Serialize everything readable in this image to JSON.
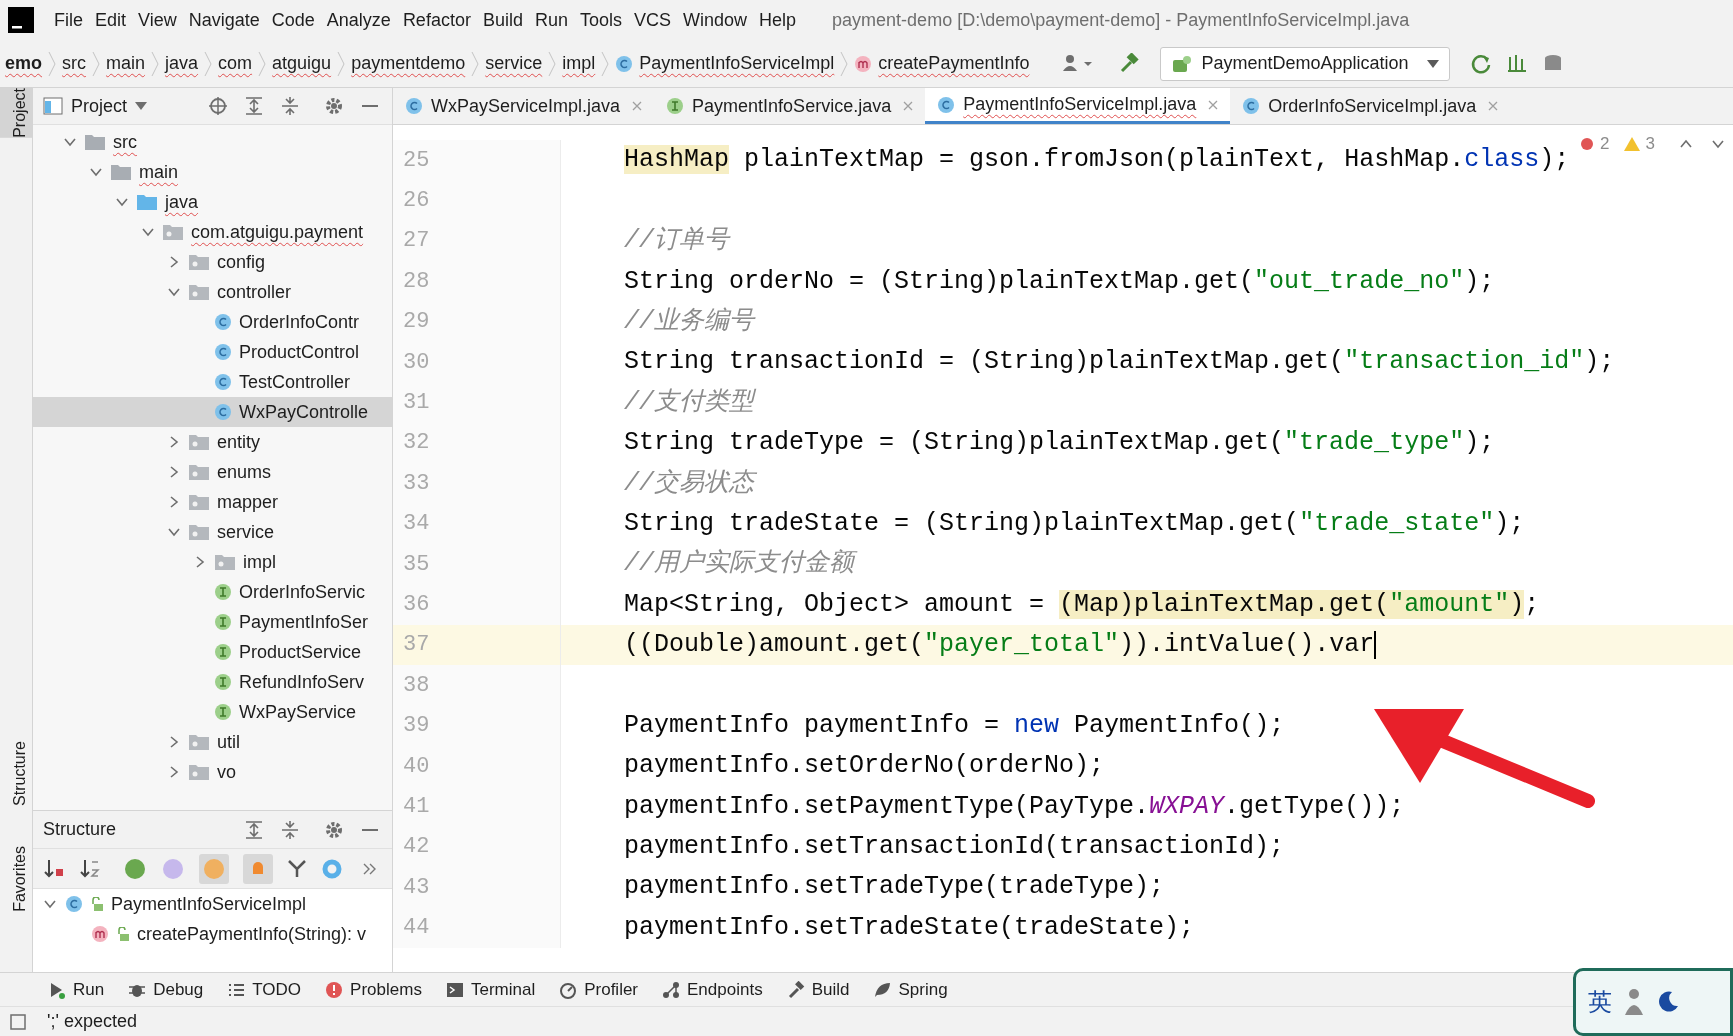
{
  "menu": [
    "File",
    "Edit",
    "View",
    "Navigate",
    "Code",
    "Analyze",
    "Refactor",
    "Build",
    "Run",
    "Tools",
    "VCS",
    "Window",
    "Help"
  ],
  "window": {
    "title": "payment-demo [D:\\demo\\payment-demo] - PaymentInfoServiceImpl.java"
  },
  "breadcrumbs": [
    {
      "label": "emo",
      "kind": "plain"
    },
    {
      "label": "src",
      "kind": "plain"
    },
    {
      "label": "main",
      "kind": "plain"
    },
    {
      "label": "java",
      "kind": "plain"
    },
    {
      "label": "com",
      "kind": "plain"
    },
    {
      "label": "atguigu",
      "kind": "plain"
    },
    {
      "label": "paymentdemo",
      "kind": "plain"
    },
    {
      "label": "service",
      "kind": "plain"
    },
    {
      "label": "impl",
      "kind": "plain"
    },
    {
      "label": "PaymentInfoServiceImpl",
      "kind": "class"
    },
    {
      "label": "createPaymentInfo",
      "kind": "method"
    }
  ],
  "run_config": "PaymentDemoApplication",
  "side_stripe": {
    "top": [
      {
        "label": "Project",
        "selected": true
      }
    ],
    "bottom": [
      {
        "label": "Structure",
        "selected": false
      },
      {
        "label": "Favorites",
        "selected": false
      }
    ]
  },
  "project_panel": {
    "title": "Project",
    "tree": [
      {
        "label": "src",
        "kind": "folder",
        "expanded": true,
        "selected": false,
        "children": [
          {
            "label": "main",
            "kind": "folder",
            "expanded": true,
            "selected": false,
            "children": [
              {
                "label": "java",
                "kind": "source",
                "expanded": true,
                "selected": false,
                "children": [
                  {
                    "label": "com.atguigu.payment",
                    "kind": "package",
                    "expanded": true,
                    "selected": false,
                    "children": [
                      {
                        "label": "config",
                        "kind": "package",
                        "expanded": false,
                        "selected": false
                      },
                      {
                        "label": "controller",
                        "kind": "package",
                        "expanded": true,
                        "selected": false,
                        "children": [
                          {
                            "label": "OrderInfoContr",
                            "kind": "class",
                            "selected": false
                          },
                          {
                            "label": "ProductControl",
                            "kind": "class",
                            "selected": false
                          },
                          {
                            "label": "TestController",
                            "kind": "class",
                            "selected": false
                          },
                          {
                            "label": "WxPayControlle",
                            "kind": "class",
                            "selected": true
                          }
                        ]
                      },
                      {
                        "label": "entity",
                        "kind": "package",
                        "expanded": false,
                        "selected": false
                      },
                      {
                        "label": "enums",
                        "kind": "package",
                        "expanded": false,
                        "selected": false
                      },
                      {
                        "label": "mapper",
                        "kind": "package",
                        "expanded": false,
                        "selected": false
                      },
                      {
                        "label": "service",
                        "kind": "package",
                        "expanded": true,
                        "selected": false,
                        "children": [
                          {
                            "label": "impl",
                            "kind": "package",
                            "expanded": false,
                            "selected": false
                          },
                          {
                            "label": "OrderInfoServic",
                            "kind": "interface",
                            "selected": false
                          },
                          {
                            "label": "PaymentInfoSer",
                            "kind": "interface",
                            "selected": false
                          },
                          {
                            "label": "ProductService",
                            "kind": "interface",
                            "selected": false
                          },
                          {
                            "label": "RefundInfoServ",
                            "kind": "interface",
                            "selected": false
                          },
                          {
                            "label": "WxPayService",
                            "kind": "interface",
                            "selected": false
                          }
                        ]
                      },
                      {
                        "label": "util",
                        "kind": "package",
                        "expanded": false,
                        "selected": false
                      },
                      {
                        "label": "vo",
                        "kind": "package",
                        "expanded": false,
                        "selected": false
                      }
                    ]
                  }
                ]
              }
            ]
          }
        ]
      }
    ]
  },
  "structure_panel": {
    "title": "Structure",
    "tree": [
      {
        "label": "PaymentInfoServiceImpl",
        "kind": "class",
        "expanded": true,
        "children": [
          {
            "label": "createPaymentInfo(String): v",
            "kind": "method"
          }
        ]
      }
    ]
  },
  "tabs": [
    {
      "label": "WxPayServiceImpl.java",
      "kind": "class",
      "selected": false
    },
    {
      "label": "PaymentInfoService.java",
      "kind": "interface",
      "selected": false
    },
    {
      "label": "PaymentInfoServiceImpl.java",
      "kind": "class",
      "selected": true
    },
    {
      "label": "OrderInfoServiceImpl.java",
      "kind": "class",
      "selected": false
    }
  ],
  "inspections": {
    "errors": "2",
    "warnings": "3"
  },
  "code": [
    {
      "number": "25",
      "current": false,
      "tokens": [
        {
          "text": "HashMap",
          "kind": "highlight"
        },
        {
          "text": " plainTextMap = gson.fromJson(plainText, HashMap.",
          "kind": "plain"
        },
        {
          "text": "class",
          "kind": "keyword"
        },
        {
          "text": ");",
          "kind": "plain"
        }
      ]
    },
    {
      "number": "26",
      "current": false
    },
    {
      "number": "27",
      "current": false,
      "tokens": [
        {
          "text": "//订单号",
          "kind": "comment"
        }
      ]
    },
    {
      "number": "28",
      "current": false,
      "tokens": [
        {
          "text": "String orderNo = (String)plainTextMap.get(",
          "kind": "plain"
        },
        {
          "text": "\"out_trade_no\"",
          "kind": "string"
        },
        {
          "text": ");",
          "kind": "plain"
        }
      ]
    },
    {
      "number": "29",
      "current": false,
      "tokens": [
        {
          "text": "//业务编号",
          "kind": "comment"
        }
      ]
    },
    {
      "number": "30",
      "current": false,
      "tokens": [
        {
          "text": "String transactionId = (String)plainTextMap.get(",
          "kind": "plain"
        },
        {
          "text": "\"transaction_id\"",
          "kind": "string"
        },
        {
          "text": ");",
          "kind": "plain"
        }
      ]
    },
    {
      "number": "31",
      "current": false,
      "tokens": [
        {
          "text": "//支付类型",
          "kind": "comment"
        }
      ]
    },
    {
      "number": "32",
      "current": false,
      "tokens": [
        {
          "text": "String tradeType = (String)plainTextMap.get(",
          "kind": "plain"
        },
        {
          "text": "\"trade_type\"",
          "kind": "string"
        },
        {
          "text": ");",
          "kind": "plain"
        }
      ]
    },
    {
      "number": "33",
      "current": false,
      "tokens": [
        {
          "text": "//交易状态",
          "kind": "comment"
        }
      ]
    },
    {
      "number": "34",
      "current": false,
      "tokens": [
        {
          "text": "String tradeState = (String)plainTextMap.get(",
          "kind": "plain"
        },
        {
          "text": "\"trade_state\"",
          "kind": "string"
        },
        {
          "text": ");",
          "kind": "plain"
        }
      ]
    },
    {
      "number": "35",
      "current": false,
      "tokens": [
        {
          "text": "//用户实际支付金额",
          "kind": "comment"
        }
      ]
    },
    {
      "number": "36",
      "current": false,
      "tokens": [
        {
          "text": "Map<String, Object> amount = ",
          "kind": "plain"
        },
        {
          "text": "(Map)plainTextMap.get(",
          "kind": "highlight"
        },
        {
          "text": "\"amount\"",
          "kind": "highlight-string"
        },
        {
          "text": ")",
          "kind": "highlight"
        },
        {
          "text": ";",
          "kind": "plain"
        }
      ]
    },
    {
      "number": "37",
      "current": true,
      "tokens": [
        {
          "text": "((Double)amount.get(",
          "kind": "plain"
        },
        {
          "text": "\"payer_total\"",
          "kind": "string"
        },
        {
          "text": ")).intValue().var",
          "kind": "plain"
        }
      ]
    },
    {
      "number": "38",
      "current": false
    },
    {
      "number": "39",
      "current": false,
      "tokens": [
        {
          "text": "PaymentInfo paymentInfo = ",
          "kind": "plain"
        },
        {
          "text": "new",
          "kind": "keyword"
        },
        {
          "text": " PaymentInfo();",
          "kind": "plain"
        }
      ]
    },
    {
      "number": "40",
      "current": false,
      "tokens": [
        {
          "text": "paymentInfo.setOrderNo(orderNo);",
          "kind": "plain"
        }
      ]
    },
    {
      "number": "41",
      "current": false,
      "tokens": [
        {
          "text": "paymentInfo.setPaymentType(PayType.",
          "kind": "plain"
        },
        {
          "text": "WXPAY",
          "kind": "constant"
        },
        {
          "text": ".getType());",
          "kind": "plain"
        }
      ]
    },
    {
      "number": "42",
      "current": false,
      "tokens": [
        {
          "text": "paymentInfo.setTransactionId(transactionId);",
          "kind": "plain"
        }
      ]
    },
    {
      "number": "43",
      "current": false,
      "tokens": [
        {
          "text": "paymentInfo.setTradeType(tradeType);",
          "kind": "plain"
        }
      ]
    },
    {
      "number": "44",
      "current": false,
      "tokens": [
        {
          "text": "paymentInfo.setTradeState(tradeState);",
          "kind": "plain"
        }
      ]
    }
  ],
  "tool_windows": [
    "Run",
    "Debug",
    "TODO",
    "Problems",
    "Terminal",
    "Profiler",
    "Endpoints",
    "Build",
    "Spring"
  ],
  "status_bar": {
    "message": "';' expected"
  },
  "ime_bar": {
    "label": "英"
  }
}
